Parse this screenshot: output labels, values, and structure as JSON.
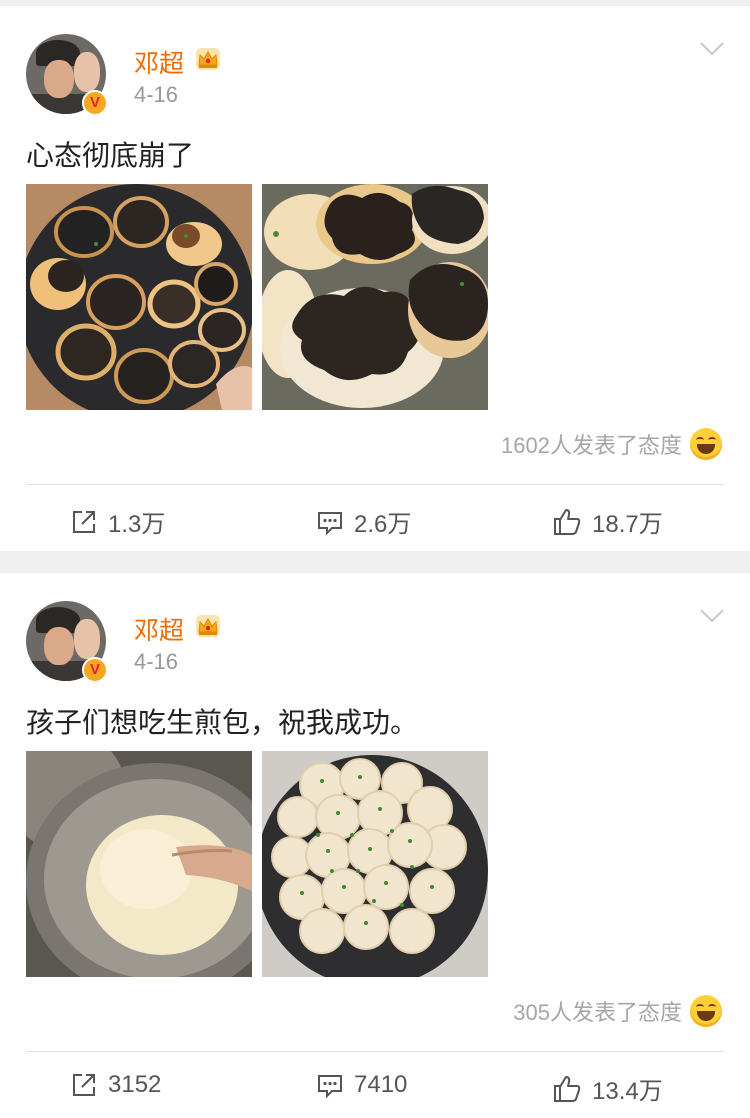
{
  "posts": [
    {
      "username": "邓超",
      "date": "4-16",
      "text": "心态彻底崩了",
      "photo_alts": [
        "burnt-buns-in-pan",
        "burnt-buns-closeup"
      ],
      "reactions_count": "1602",
      "reactions_text": "人发表了态度",
      "reposts": "1.3万",
      "comments": "2.6万",
      "likes": "18.7万"
    },
    {
      "username": "邓超",
      "date": "4-16",
      "text": "孩子们想吃生煎包，祝我成功。",
      "photo_alts": [
        "dough-kneading",
        "buns-with-scallions"
      ],
      "reactions_count": "305",
      "reactions_text": "人发表了态度",
      "reposts": "3152",
      "comments": "7410",
      "likes": "13.4万"
    }
  ],
  "icons": {
    "verified": "V",
    "crown": "crown-icon",
    "chevron": "chevron-down-icon",
    "repost": "repost-icon",
    "comment": "comment-icon",
    "like": "thumbs-up-icon",
    "reaction": "laughing-emoji-icon"
  },
  "colors": {
    "username": "#f06c00",
    "background": "#efefef",
    "verified_badge": "#f5a623"
  }
}
